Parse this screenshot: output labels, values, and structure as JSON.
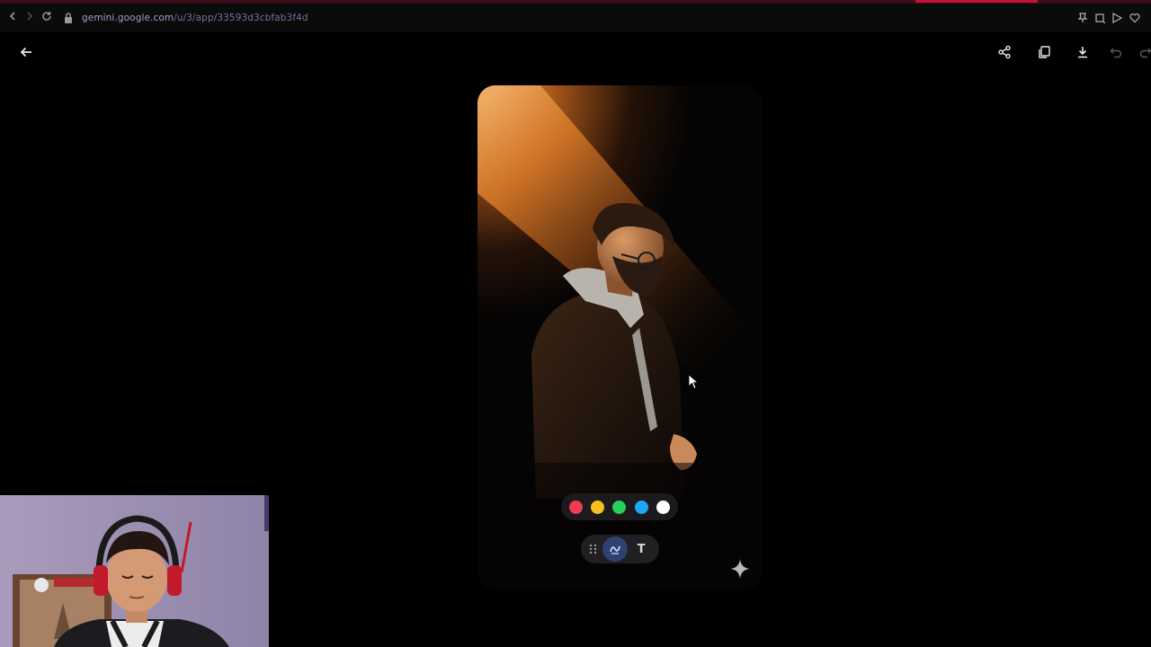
{
  "browser": {
    "url_host": "gemini.google.com",
    "url_path": "/u/3/app/33593d3cbfab3f4d",
    "icons": [
      "back-icon",
      "forward-icon",
      "reload-icon",
      "lock-icon",
      "pin-icon",
      "crop-icon",
      "play-icon",
      "heart-icon"
    ]
  },
  "viewer": {
    "toolbar_icons": [
      "back-arrow-icon",
      "share-icon",
      "copy-icon",
      "download-icon",
      "undo-icon",
      "redo-icon"
    ],
    "image_subject": "man-in-spotlight",
    "palette": [
      {
        "name": "red",
        "color": "#f03c4e"
      },
      {
        "name": "yellow",
        "color": "#f4c01c"
      },
      {
        "name": "green",
        "color": "#26d05a"
      },
      {
        "name": "blue",
        "color": "#1ea7f5"
      },
      {
        "name": "white",
        "color": "#ffffff"
      }
    ],
    "text_tool_label": "T",
    "accent": "#2e4170"
  },
  "colors": {
    "background": "#000000",
    "spotlight": "#e8913a",
    "tab_accent": "#c4123a"
  }
}
